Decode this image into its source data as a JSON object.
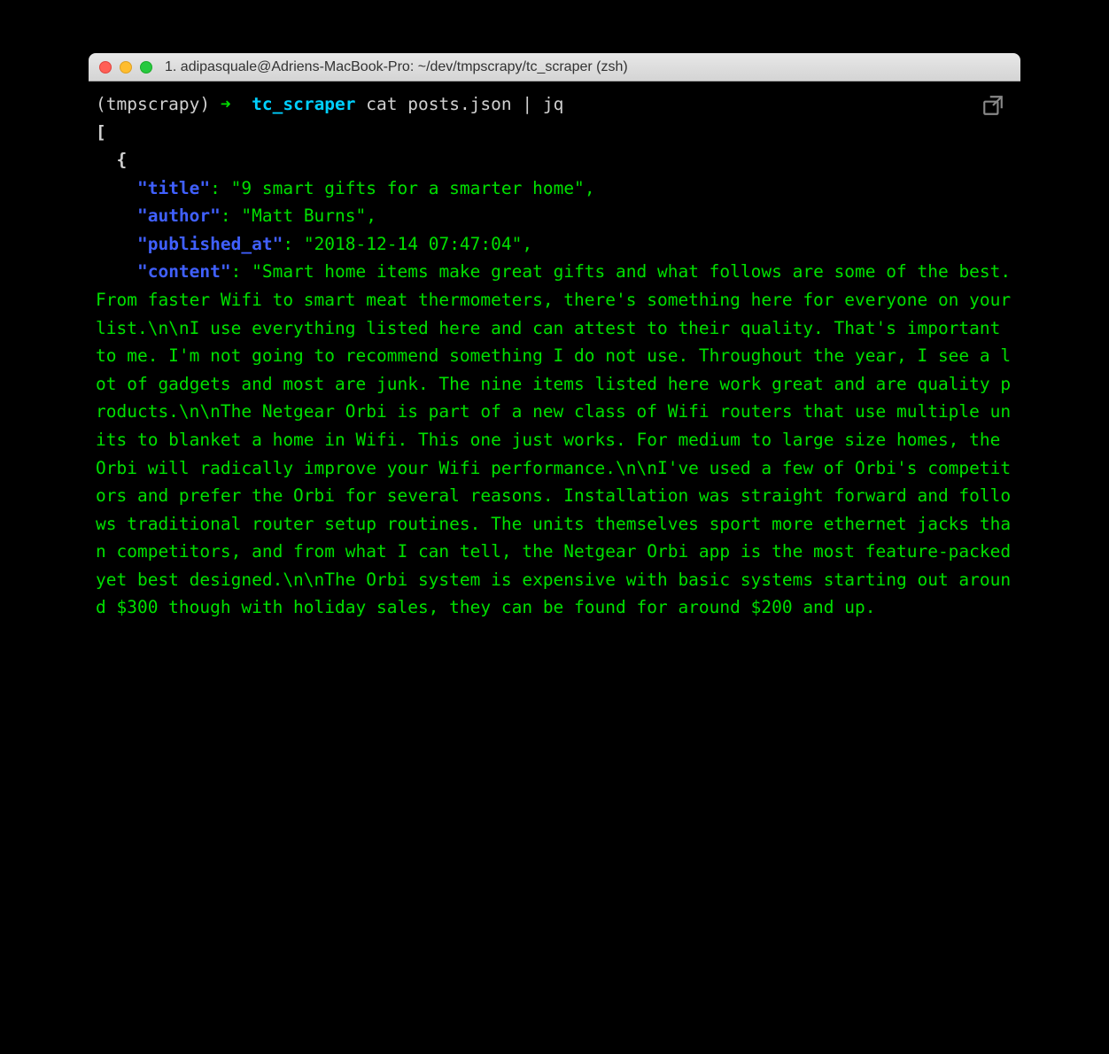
{
  "titlebar": {
    "title": "1. adipasquale@Adriens-MacBook-Pro: ~/dev/tmpscrapy/tc_scraper (zsh)"
  },
  "prompt": {
    "env": "(tmpscrapy)",
    "arrow": "➜",
    "dir": "tc_scraper",
    "command": "cat posts.json | jq"
  },
  "json_output": {
    "open_array": "[",
    "open_object": "{",
    "keys": {
      "title": "\"title\"",
      "author": "\"author\"",
      "published_at": "\"published_at\"",
      "content": "\"content\""
    },
    "values": {
      "title": "\"9 smart gifts for a smarter home\"",
      "author": "\"Matt Burns\"",
      "published_at": "\"2018-12-14 07:47:04\"",
      "content": "\"Smart home items make great gifts and what follows are some of the best. From faster Wifi to smart meat thermometers, there's something here for everyone on your list.\\n\\nI use everything listed here and can attest to their quality. That's important to me. I'm not going to recommend something I do not use. Throughout the year, I see a lot of gadgets and most are junk. The nine items listed here work great and are quality products.\\n\\nThe Netgear Orbi is part of a new class of Wifi routers that use multiple units to blanket a home in Wifi. This one just works. For medium to large size homes, the Orbi will radically improve your Wifi performance.\\n\\nI've used a few of Orbi's competitors and prefer the Orbi for several reasons. Installation was straight forward and follows traditional router setup routines. The units themselves sport more ethernet jacks than competitors, and from what I can tell, the Netgear Orbi app is the most feature-packed yet best designed.\\n\\nThe Orbi system is expensive with basic systems starting out around $300 though with holiday sales, they can be found for around $200 and up."
    },
    "colon": ": ",
    "comma": ","
  }
}
